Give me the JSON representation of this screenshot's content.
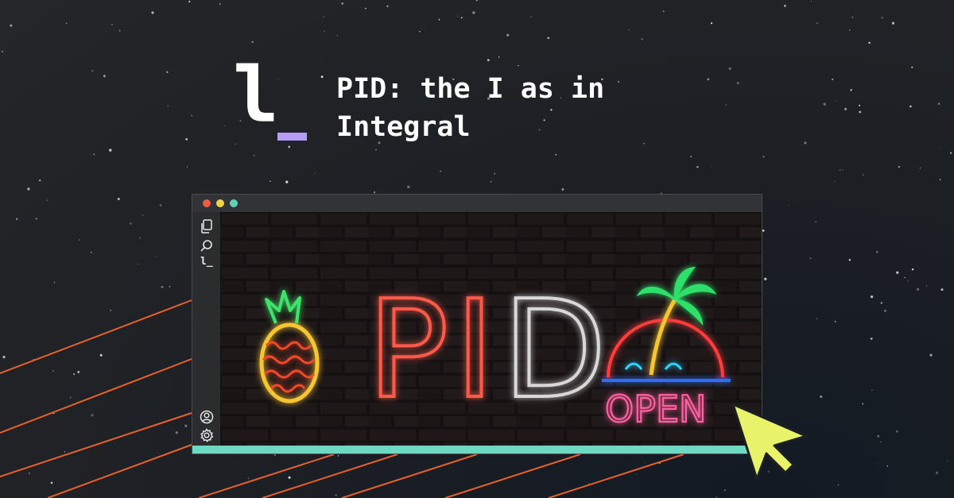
{
  "logo": {
    "glyph": "l"
  },
  "title": "PID: the I as in Integral",
  "colors": {
    "accent_purple": "#b79cf5",
    "progress_teal": "#6fd8c2",
    "stripe_orange": "#e8602c",
    "cursor_yellow": "#e9f36a",
    "window_dot_red": "#ef5a42",
    "window_dot_yellow": "#f0d24b",
    "window_dot_green": "#5fd3b5"
  },
  "window": {
    "sidebar_icons": [
      "files-icon",
      "search-icon",
      "logo-icon",
      "account-icon",
      "settings-icon"
    ],
    "sidebar_logo_text": "l_",
    "neon_sign": {
      "letters": [
        "P",
        "I",
        "D"
      ],
      "open_text": "OPEN",
      "icons": [
        "pineapple-icon",
        "palm-tree-icon"
      ]
    },
    "progress": 1.0
  }
}
